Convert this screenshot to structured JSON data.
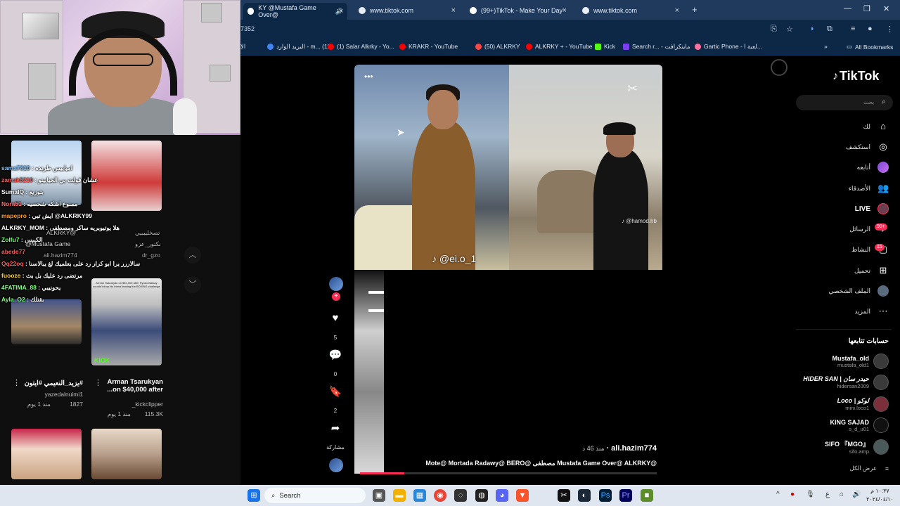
{
  "browser": {
    "tabs": [
      {
        "label": "KY @Mustafa Game Over@",
        "active": true
      },
      {
        "label": "www.tiktok.com",
        "active": false
      },
      {
        "label": "(99+)TikTok - Make Your Day",
        "active": false
      },
      {
        "label": "www.tiktok.com",
        "active": false
      }
    ],
    "new_tab": "+",
    "url": "7352",
    "bookmarks": [
      "الا",
      "البريد الوارد - m... (11)",
      "(1) Salar Alkrky - Yo...",
      "KRAKR - YouTube",
      "(50) ALKRKY",
      "ALKRKY + - YouTube",
      "Kick",
      "Search r... - ماينكرافت",
      "Gartic Phone - لعبة ا...",
      "»",
      "All Bookmarks"
    ]
  },
  "stream": {
    "chat": [
      {
        "user": "sama7810",
        "msg": "اميابيس طرنده",
        "color": "#7ec4ff"
      },
      {
        "user": "zamak5210",
        "msg": "عشان قولت بي الحيابينو",
        "color": "#ff5a5a"
      },
      {
        "user": "SumaIQ",
        "msg": "بتوزيع",
        "color": "#ffffff"
      },
      {
        "user": "Nora51",
        "msg": "ممنوع اشكه شخصيه",
        "color": "#ff6b6b"
      },
      {
        "user": "mapepro",
        "msg": "ايش تبي",
        "color": "#ff9a3c"
      },
      {
        "user": "@ALKRKY99",
        "msg": "",
        "color": "#ffffff"
      },
      {
        "user": "ALKRKY_MOM",
        "msg": "هلا يوتيوبريه ساكر ومصطفى",
        "color": "#ffffff"
      },
      {
        "user": "Zolfu7",
        "msg": "الكبيس",
        "color": "#7dff7d"
      },
      {
        "user": "abede77",
        "msg": "",
        "color": "#ff5a5a"
      },
      {
        "user": "Qq22oq",
        "msg": "سالاررر يرا ابو كرار رد على بعلميك لغ يبالاسنا",
        "color": "#ff5a5a"
      },
      {
        "user": "fuooze",
        "msg": "مرتضى رد عليك بل بث",
        "color": "#ffd24a"
      },
      {
        "user": "4FATIMA_88",
        "msg": "يحونيبي",
        "color": "#7dff7d"
      },
      {
        "user": "Ayla_O2",
        "msg": "بقتلك",
        "color": "#7dff7d"
      }
    ],
    "overlay_tags": [
      "ALKRKY@",
      "@Mustafa Game",
      "ali.hazim774",
      "dr_gzo",
      "تصخليببيي",
      "نكتور_عزو"
    ],
    "shorts": [
      {
        "title": "Arman Tsarukyan on $40,000 after...",
        "channel": "kickclipper_",
        "views": "115.3K",
        "age": "منذ 1 يوم"
      },
      {
        "title": "#يزيد_النعيمي #ايتون",
        "channel": "yazedalnuimi1",
        "views": "1827",
        "age": "منذ 1 يوم"
      }
    ],
    "thumb_text": [
      "KICK",
      "Arman Tsarukyan on $40,000 after Ryoko Barkay couldn't drop his friend leaving the BOXING challenge"
    ]
  },
  "tiktok": {
    "logo": "TikTok",
    "search_placeholder": "بحث",
    "nav": [
      {
        "label": "لك",
        "icon": "home-icon"
      },
      {
        "label": "استكشف",
        "icon": "compass-icon"
      },
      {
        "label": "أتابعه",
        "icon": "avatar-icon"
      },
      {
        "label": "الأصدقاء",
        "icon": "friends-icon"
      },
      {
        "label": "LIVE",
        "icon": "live-icon"
      },
      {
        "label": "الرسائل",
        "icon": "inbox-icon",
        "badge": "99+"
      },
      {
        "label": "النشاط",
        "icon": "activity-icon",
        "badge": "15"
      },
      {
        "label": "تحميل",
        "icon": "upload-icon"
      },
      {
        "label": "الملف الشخصي",
        "icon": "profile-icon"
      },
      {
        "label": "المزيد",
        "icon": "more-icon"
      }
    ],
    "following_title": "حسابات تتابعها",
    "following": [
      {
        "name": "Mustafa_old",
        "handle": "mustafa_old1"
      },
      {
        "name": "HIDER SAN | حيدر سان",
        "handle": "hidersan2009"
      },
      {
        "name": "Loco | لوكو",
        "handle": "mini.loco1"
      },
      {
        "name": "KING SAJAD",
        "handle": "s_d_u01"
      },
      {
        "name": "SIFO 『MGO』",
        "handle": "sifo.amp"
      }
    ],
    "see_all": "عرض الكل",
    "video": {
      "watermark": "@ei.o_1",
      "watermark2": "@hamod.hb",
      "author": "ali.hazim774",
      "age": "منذ 46 د",
      "caption": "Mote@ Mortada Radawy@ BERO@ مصطفى Mustafa Game Over@ ALKRKY@",
      "likes": "5",
      "comments": "0",
      "saves": "2",
      "share_label": "مشاركة",
      "progress": 0.15
    }
  },
  "taskbar": {
    "search": "Search",
    "time": "١٠:٣٧ م",
    "date": "٢٠٢٤/٠٤/١٠",
    "lang": "ع"
  }
}
